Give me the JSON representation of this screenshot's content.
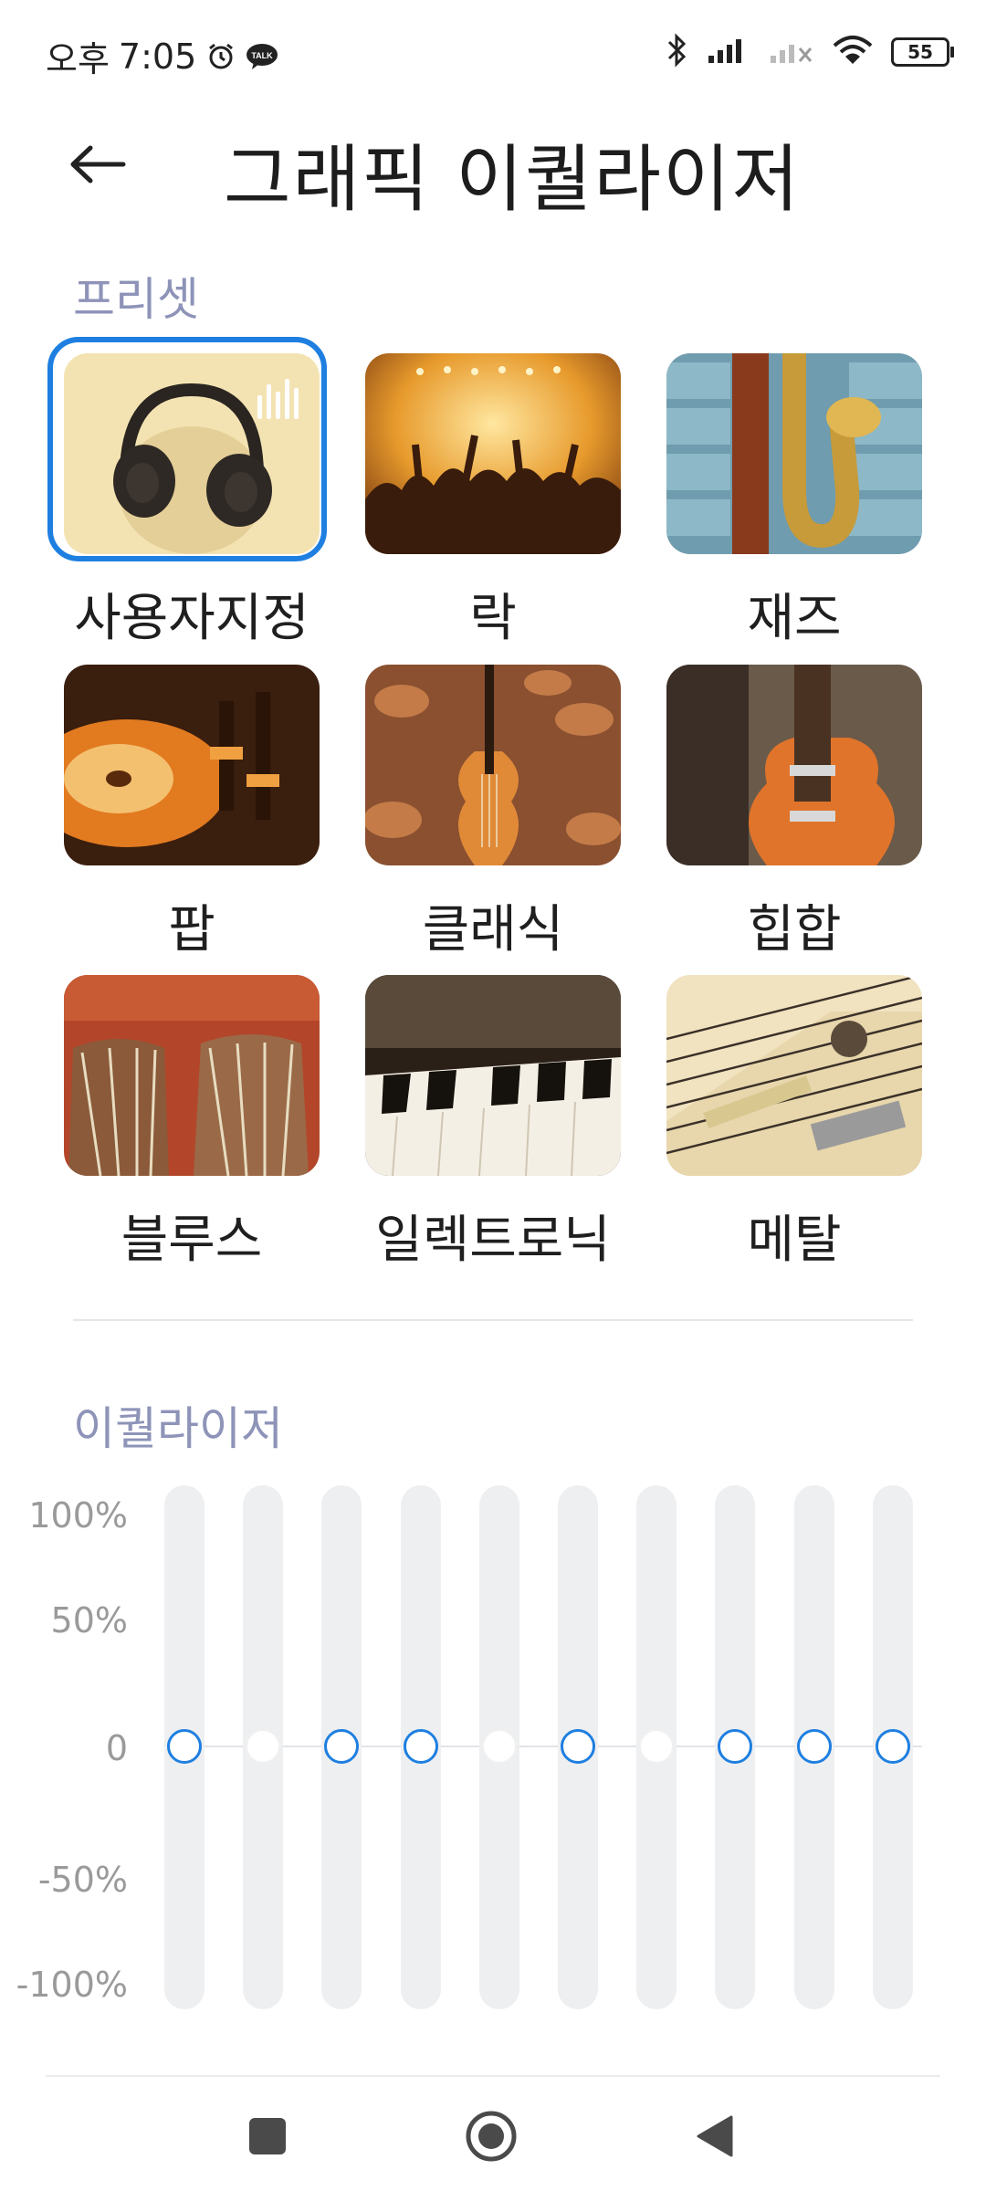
{
  "status_bar": {
    "ampm": "오후",
    "time": "7:05",
    "battery": "55"
  },
  "header": {
    "title": "그래픽 이퀄라이저"
  },
  "presets": {
    "label": "프리셋",
    "items": [
      {
        "label": "사용자지정",
        "image": "headphones",
        "selected": true
      },
      {
        "label": "락",
        "image": "concert-crowd"
      },
      {
        "label": "재즈",
        "image": "saxophone"
      },
      {
        "label": "팝",
        "image": "dj-turntable"
      },
      {
        "label": "클래식",
        "image": "violin"
      },
      {
        "label": "힙합",
        "image": "electric-guitar"
      },
      {
        "label": "블루스",
        "image": "drums"
      },
      {
        "label": "일렉트로닉",
        "image": "piano-keys"
      },
      {
        "label": "메탈",
        "image": "guitar-strings"
      }
    ]
  },
  "equalizer": {
    "label": "이퀄라이저",
    "axis": [
      "100%",
      "50%",
      "0",
      "-50%",
      "-100%"
    ],
    "bands": [
      {
        "level": 0,
        "active": true
      },
      {
        "level": 0,
        "active": false
      },
      {
        "level": 0,
        "active": true
      },
      {
        "level": 0,
        "active": true
      },
      {
        "level": 0,
        "active": false
      },
      {
        "level": 0,
        "active": true
      },
      {
        "level": 0,
        "active": false
      },
      {
        "level": 0,
        "active": true
      },
      {
        "level": 0,
        "active": true
      },
      {
        "level": 0,
        "active": true
      }
    ]
  },
  "colors": {
    "accent": "#1e7fe0",
    "section_label": "#8e93b8",
    "track": "#eeeff1"
  }
}
